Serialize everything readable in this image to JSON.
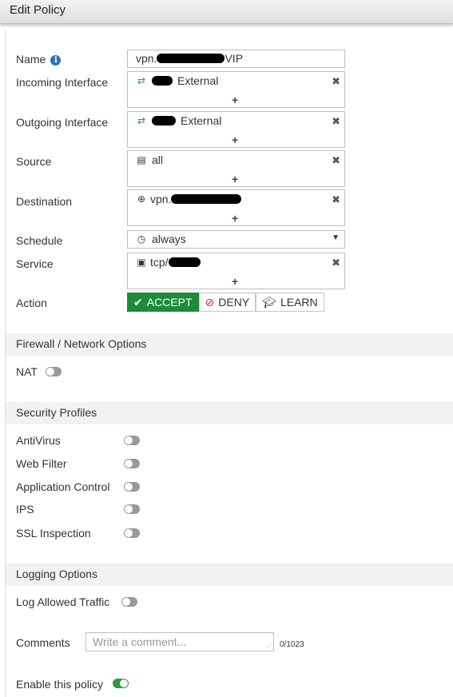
{
  "window": {
    "title": "Edit Policy"
  },
  "form": {
    "name_label": "Name",
    "name_prefix": "vpn.",
    "name_suffix": "VIP",
    "incoming_label": "Incoming Interface",
    "incoming_value": "External",
    "outgoing_label": "Outgoing Interface",
    "outgoing_value": "External",
    "source_label": "Source",
    "source_value": "all",
    "destination_label": "Destination",
    "destination_value": "vpn.",
    "schedule_label": "Schedule",
    "schedule_value": "always",
    "service_label": "Service",
    "service_value": "tcp/",
    "action_label": "Action",
    "add_symbol": "+",
    "remove_symbol": "✖",
    "actions": [
      {
        "label": "ACCEPT",
        "icon": "check-icon",
        "selected": true
      },
      {
        "label": "DENY",
        "icon": "deny-icon",
        "selected": false
      },
      {
        "label": "LEARN",
        "icon": "learn-icon",
        "selected": false
      }
    ]
  },
  "firewall_options": {
    "heading": "Firewall / Network Options",
    "nat_label": "NAT",
    "nat_enabled": false
  },
  "security_profiles": {
    "heading": "Security Profiles",
    "items": [
      {
        "label": "AntiVirus",
        "enabled": false
      },
      {
        "label": "Web Filter",
        "enabled": false
      },
      {
        "label": "Application Control",
        "enabled": false
      },
      {
        "label": "IPS",
        "enabled": false
      },
      {
        "label": "SSL Inspection",
        "enabled": false
      }
    ]
  },
  "logging": {
    "heading": "Logging Options",
    "log_allowed_label": "Log Allowed Traffic",
    "log_allowed_enabled": false
  },
  "comments": {
    "label": "Comments",
    "placeholder": "Write a comment...",
    "counter": "0/1023"
  },
  "enable_policy": {
    "label": "Enable this policy",
    "enabled": true
  },
  "colors": {
    "accept_green": "#1e8a3a",
    "toggle_on": "#2c9a45",
    "toggle_off": "#999999",
    "info_blue": "#3072b5"
  }
}
